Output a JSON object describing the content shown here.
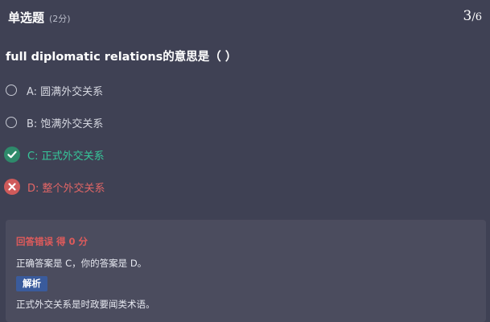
{
  "header": {
    "type_label": "单选题",
    "score_label": "(2分)",
    "progress_current": "3",
    "progress_total": "/6"
  },
  "question": {
    "text": "full diplomatic relations的意思是（ ）"
  },
  "options": [
    {
      "text": "A: 圆满外交关系",
      "state": "unselected"
    },
    {
      "text": "B: 饱满外交关系",
      "state": "unselected"
    },
    {
      "text": "C: 正式外交关系",
      "state": "correct"
    },
    {
      "text": "D: 整个外交关系",
      "state": "wrong"
    }
  ],
  "result": {
    "verdict": "回答错误 得 0 分",
    "answer_line": "正确答案是 C，你的答案是 D。",
    "analysis_label": "解析",
    "analysis_text": "正式外交关系是时政要闻类术语。"
  },
  "colors": {
    "background": "#3f4154",
    "panel": "#4b4c5e",
    "correct": "#36c79a",
    "wrong": "#e26666",
    "analysis_tag": "#3a5b9c"
  },
  "icons": {
    "correct": "check-icon",
    "wrong": "x-icon",
    "unselected": "radio-icon"
  }
}
